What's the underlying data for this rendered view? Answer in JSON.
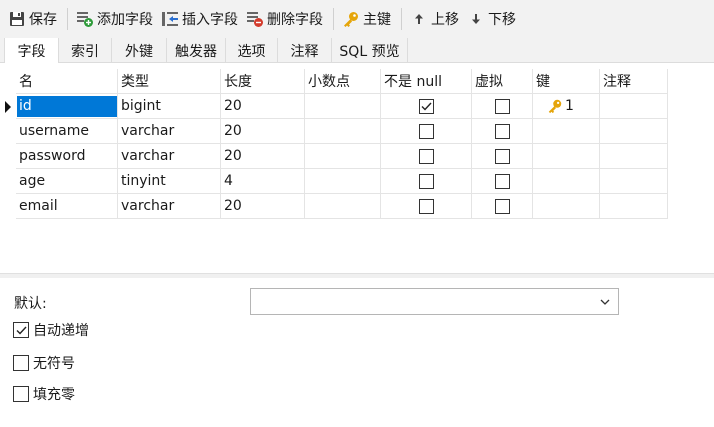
{
  "toolbar": {
    "save": "保存",
    "add_field": "添加字段",
    "insert_field": "插入字段",
    "delete_field": "删除字段",
    "primary_key": "主键",
    "move_up": "上移",
    "move_down": "下移"
  },
  "tabs": [
    "字段",
    "索引",
    "外键",
    "触发器",
    "选项",
    "注释",
    "SQL 预览"
  ],
  "active_tab": "字段",
  "columns": [
    "名",
    "类型",
    "长度",
    "小数点",
    "不是 null",
    "虚拟",
    "键",
    "注释"
  ],
  "rows": [
    {
      "name": "id",
      "type": "bigint",
      "length": "20",
      "decimals": "",
      "not_null": true,
      "virtual": false,
      "key": "1",
      "comment": ""
    },
    {
      "name": "username",
      "type": "varchar",
      "length": "20",
      "decimals": "",
      "not_null": false,
      "virtual": false,
      "key": "",
      "comment": ""
    },
    {
      "name": "password",
      "type": "varchar",
      "length": "20",
      "decimals": "",
      "not_null": false,
      "virtual": false,
      "key": "",
      "comment": ""
    },
    {
      "name": "age",
      "type": "tinyint",
      "length": "4",
      "decimals": "",
      "not_null": false,
      "virtual": false,
      "key": "",
      "comment": ""
    },
    {
      "name": "email",
      "type": "varchar",
      "length": "20",
      "decimals": "",
      "not_null": false,
      "virtual": false,
      "key": "",
      "comment": ""
    }
  ],
  "properties": {
    "default_label": "默认:",
    "default_value": "",
    "options": [
      {
        "label": "自动递增",
        "checked": true
      },
      {
        "label": "无符号",
        "checked": false
      },
      {
        "label": "填充零",
        "checked": false
      }
    ]
  },
  "colors": {
    "selection": "#0078d7",
    "key_icon": "#e5a50a",
    "add_icon": "#2e9b3a",
    "delete_icon": "#d33b2c"
  }
}
